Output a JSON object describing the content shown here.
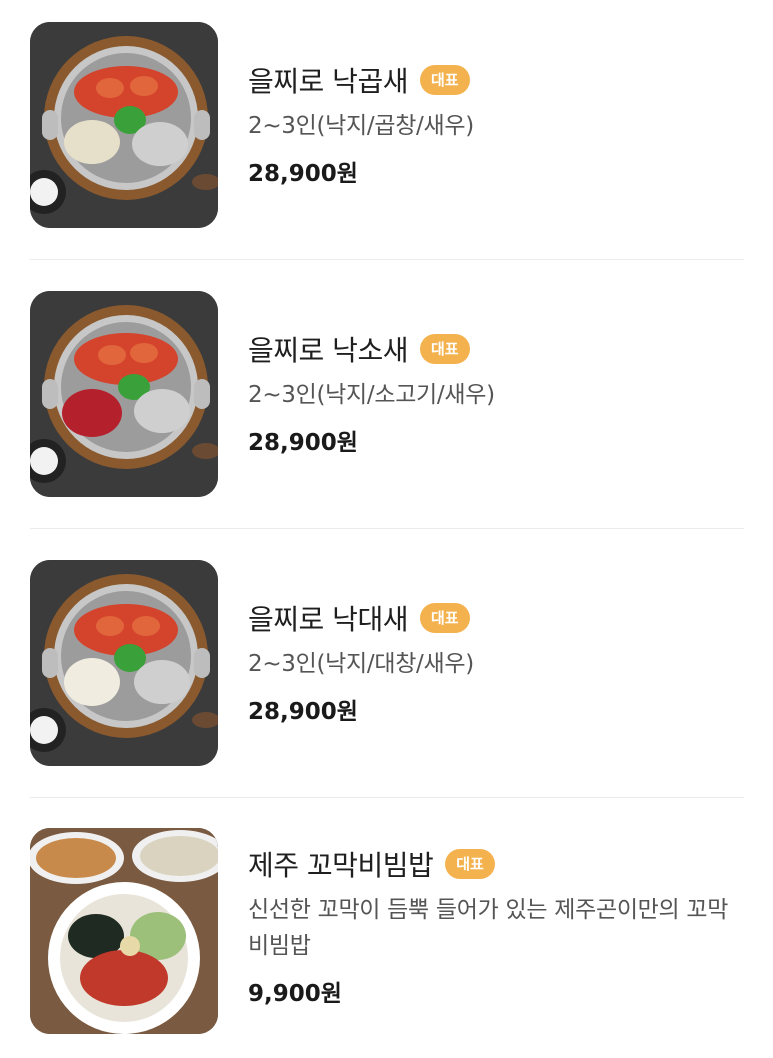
{
  "menu": {
    "items": [
      {
        "name": "을찌로 낙곱새",
        "badge": "대표",
        "description": "2~3인(낙지/곱창/새우)",
        "price": "28,900원",
        "image": "nakgopsae-hotpot-photo"
      },
      {
        "name": "을찌로 낙소새",
        "badge": "대표",
        "description": "2~3인(낙지/소고기/새우)",
        "price": "28,900원",
        "image": "naksosae-hotpot-photo"
      },
      {
        "name": "을찌로 낙대새",
        "badge": "대표",
        "description": "2~3인(낙지/대창/새우)",
        "price": "28,900원",
        "image": "nakdaesae-hotpot-photo"
      },
      {
        "name": "제주 꼬막비빔밥",
        "badge": "대표",
        "description": "신선한 꼬막이 듬뿍 들어가 있는 제주곤이만의 꼬막비빔밥",
        "price": "9,900원",
        "image": "cockle-bibimbap-photo"
      }
    ]
  },
  "colors": {
    "badge": "#f4b24e",
    "divider": "#ececec",
    "background": "#ffffff"
  }
}
